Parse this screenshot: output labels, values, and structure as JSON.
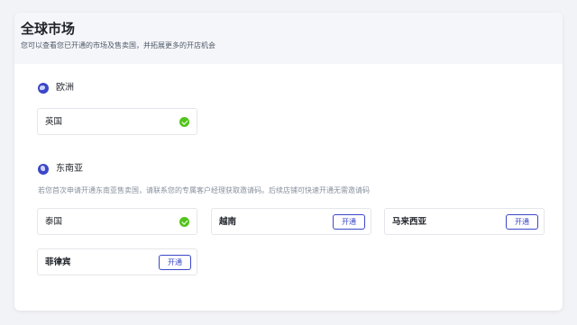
{
  "header": {
    "title": "全球市场",
    "subtitle": "您可以查看您已开通的市场及售卖国，并拓展更多的开店机会"
  },
  "regions": [
    {
      "name": "欧洲",
      "icon": "globe-europe-icon",
      "markets": [
        {
          "name": "英国",
          "status": "opened",
          "icon": "check-circle-icon"
        }
      ]
    },
    {
      "name": "东南亚",
      "icon": "globe-asia-icon",
      "notice": "若您首次申请开通东南亚售卖国，请联系您的专属客户经理获取邀请码。后续店铺可快速开通无需邀请码",
      "markets": [
        {
          "name": "泰国",
          "status": "opened",
          "icon": "check-circle-icon"
        },
        {
          "name": "越南",
          "status": "not_opened",
          "button_label": "开通"
        },
        {
          "name": "马来西亚",
          "status": "not_opened",
          "button_label": "开通"
        },
        {
          "name": "菲律宾",
          "status": "not_opened",
          "button_label": "开通"
        }
      ]
    }
  ],
  "colors": {
    "accent": "#3b47c8",
    "success": "#52c41a",
    "header_bg": "#f5f6f9"
  }
}
